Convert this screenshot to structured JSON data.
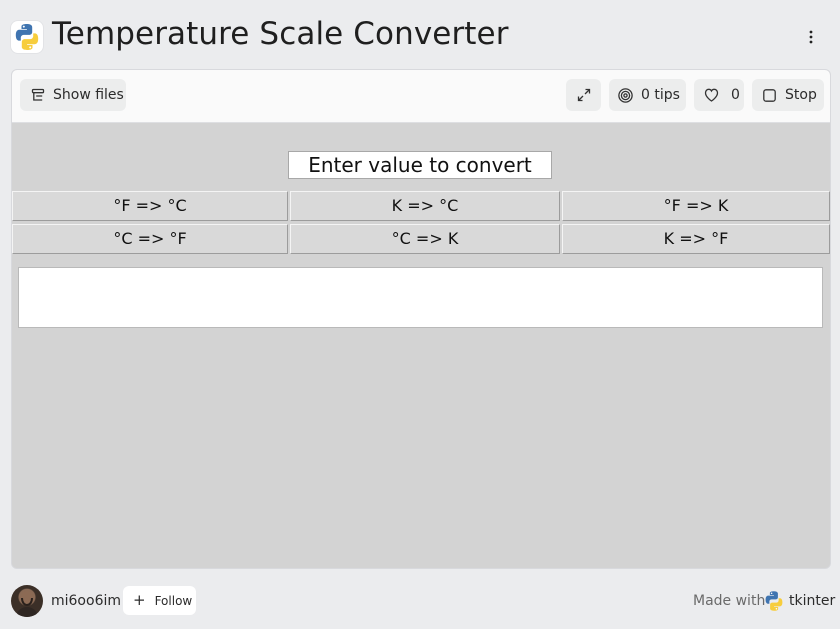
{
  "header": {
    "title": "Temperature Scale Converter",
    "logo_icon": "python-logo-icon",
    "menu_icon": "kebab-menu-icon"
  },
  "toolbar": {
    "show_files_label": "Show files",
    "tips_label": "0 tips",
    "likes_count": "0",
    "stop_label": "Stop"
  },
  "app": {
    "entry_value": "Enter value to convert",
    "buttons": [
      [
        "°F => °C",
        "K => °C",
        "°F => K"
      ],
      [
        "°C => °F",
        "°C => K",
        "K => °F"
      ]
    ],
    "output_text": "",
    "background_color": "#d3d3d3"
  },
  "footer": {
    "username": "mi6oo6im",
    "follow_label": "Follow",
    "made_with_label": "Made with",
    "framework_name": "tkinter"
  }
}
